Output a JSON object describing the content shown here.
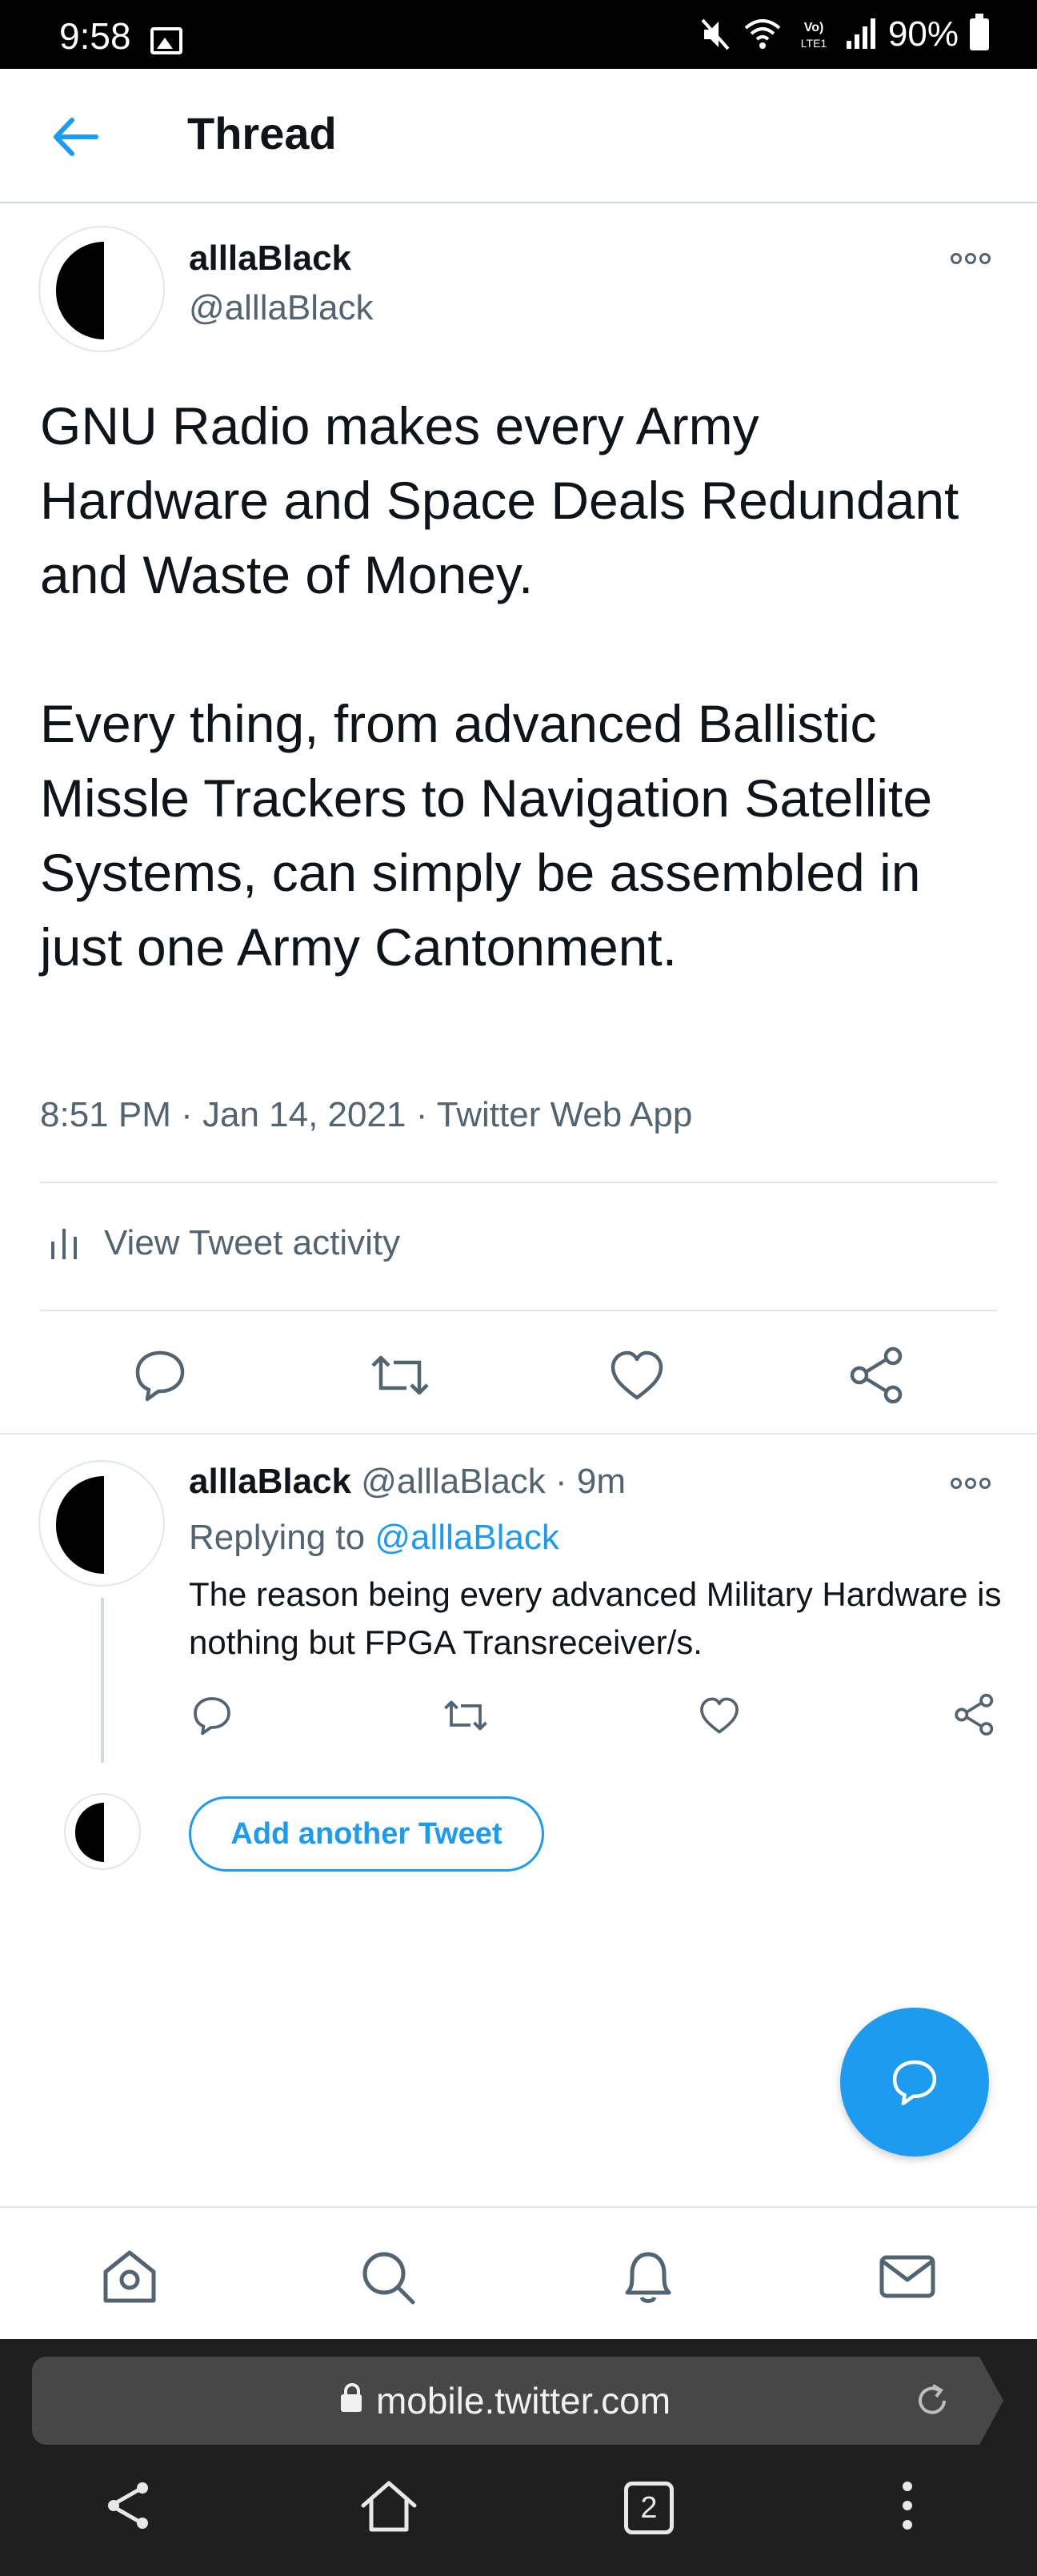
{
  "status_bar": {
    "time": "9:58",
    "battery": "90%",
    "network": "LTE1"
  },
  "header": {
    "title": "Thread"
  },
  "main_tweet": {
    "name": "alllaBlack",
    "handle": "@alllaBlack",
    "text": "GNU Radio makes every Army Hardware and Space Deals Redundant and Waste of Money.\n\nEvery thing, from advanced Ballistic Missle Trackers to Navigation Satellite Systems, can simply be assembled in just one Army Cantonment.",
    "time": "8:51 PM",
    "date": "Jan 14, 2021",
    "source": "Twitter Web App",
    "activity_label": "View Tweet activity"
  },
  "reply_tweet": {
    "name": "alllaBlack",
    "handle": "@alllaBlack",
    "age": "9m",
    "replying_prefix": "Replying to",
    "replying_handle": "@alllaBlack",
    "text": "The reason being every advanced Military Hardware is nothing but FPGA Transreceiver/s."
  },
  "compose": {
    "add_label": "Add another Tweet"
  },
  "browser": {
    "url": "mobile.twitter.com",
    "tab_count": "2"
  },
  "colors": {
    "accent": "#1d9bf0",
    "secondary_text": "#536471",
    "divider": "#e1e8ed"
  },
  "icons": {
    "back": "arrow-left-icon",
    "reply": "reply-icon",
    "retweet": "retweet-icon",
    "like": "heart-icon",
    "share": "share-icon",
    "more": "more-icon",
    "home": "home-icon",
    "search": "search-icon",
    "notifications": "bell-icon",
    "messages": "mail-icon"
  }
}
